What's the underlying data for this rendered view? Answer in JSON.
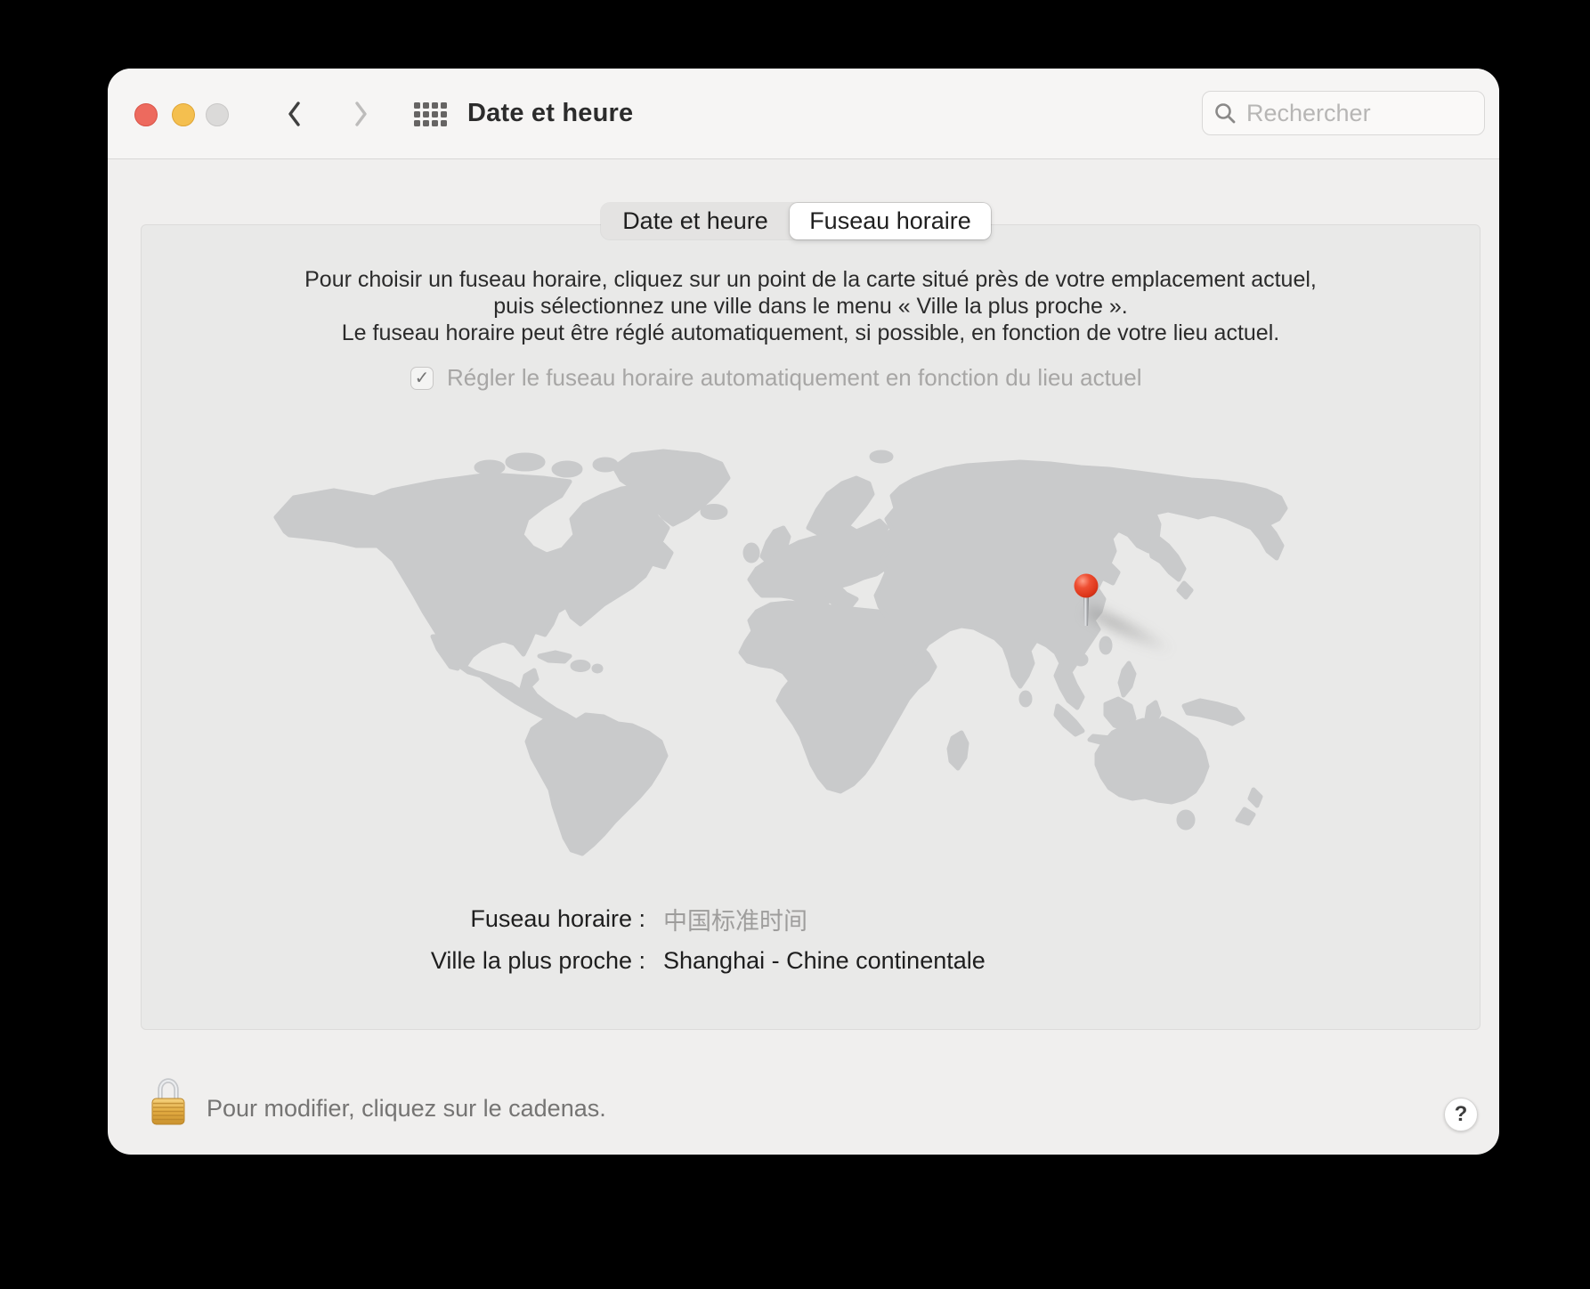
{
  "window": {
    "title": "Date et heure",
    "search": {
      "placeholder": "Rechercher"
    }
  },
  "tabs": {
    "date_time": "Date et heure",
    "time_zone": "Fuseau horaire",
    "selected": "Fuseau horaire"
  },
  "instructions": {
    "line1": "Pour choisir un fuseau horaire, cliquez sur un point de la carte situé près de votre emplacement actuel,",
    "line2": "puis sélectionnez une ville dans le menu « Ville la plus proche ».",
    "line3": "Le fuseau horaire peut être réglé automatiquement, si possible, en fonction de votre lieu actuel."
  },
  "auto_checkbox": {
    "label": "Régler le fuseau horaire automatiquement en fonction du lieu actuel",
    "checked": true,
    "enabled": false,
    "check_glyph": "✓"
  },
  "timezone_row": {
    "label": "Fuseau horaire :",
    "value": "中国标准时间"
  },
  "city_row": {
    "label": "Ville la plus proche :",
    "value": "Shanghai - Chine continentale"
  },
  "footer": {
    "lock_hint": "Pour modifier, cliquez sur le cadenas.",
    "help_label": "?"
  },
  "colors": {
    "pin_red": "#e0402c",
    "map_land": "#c9cacb",
    "panel_bg": "#e9e9e8",
    "window_bg": "#f0efee",
    "traffic_red": "#ed6a5e",
    "traffic_yellow": "#f4bf4f",
    "traffic_disabled": "#dbdad9",
    "lock_gold": "#dfa93f"
  }
}
